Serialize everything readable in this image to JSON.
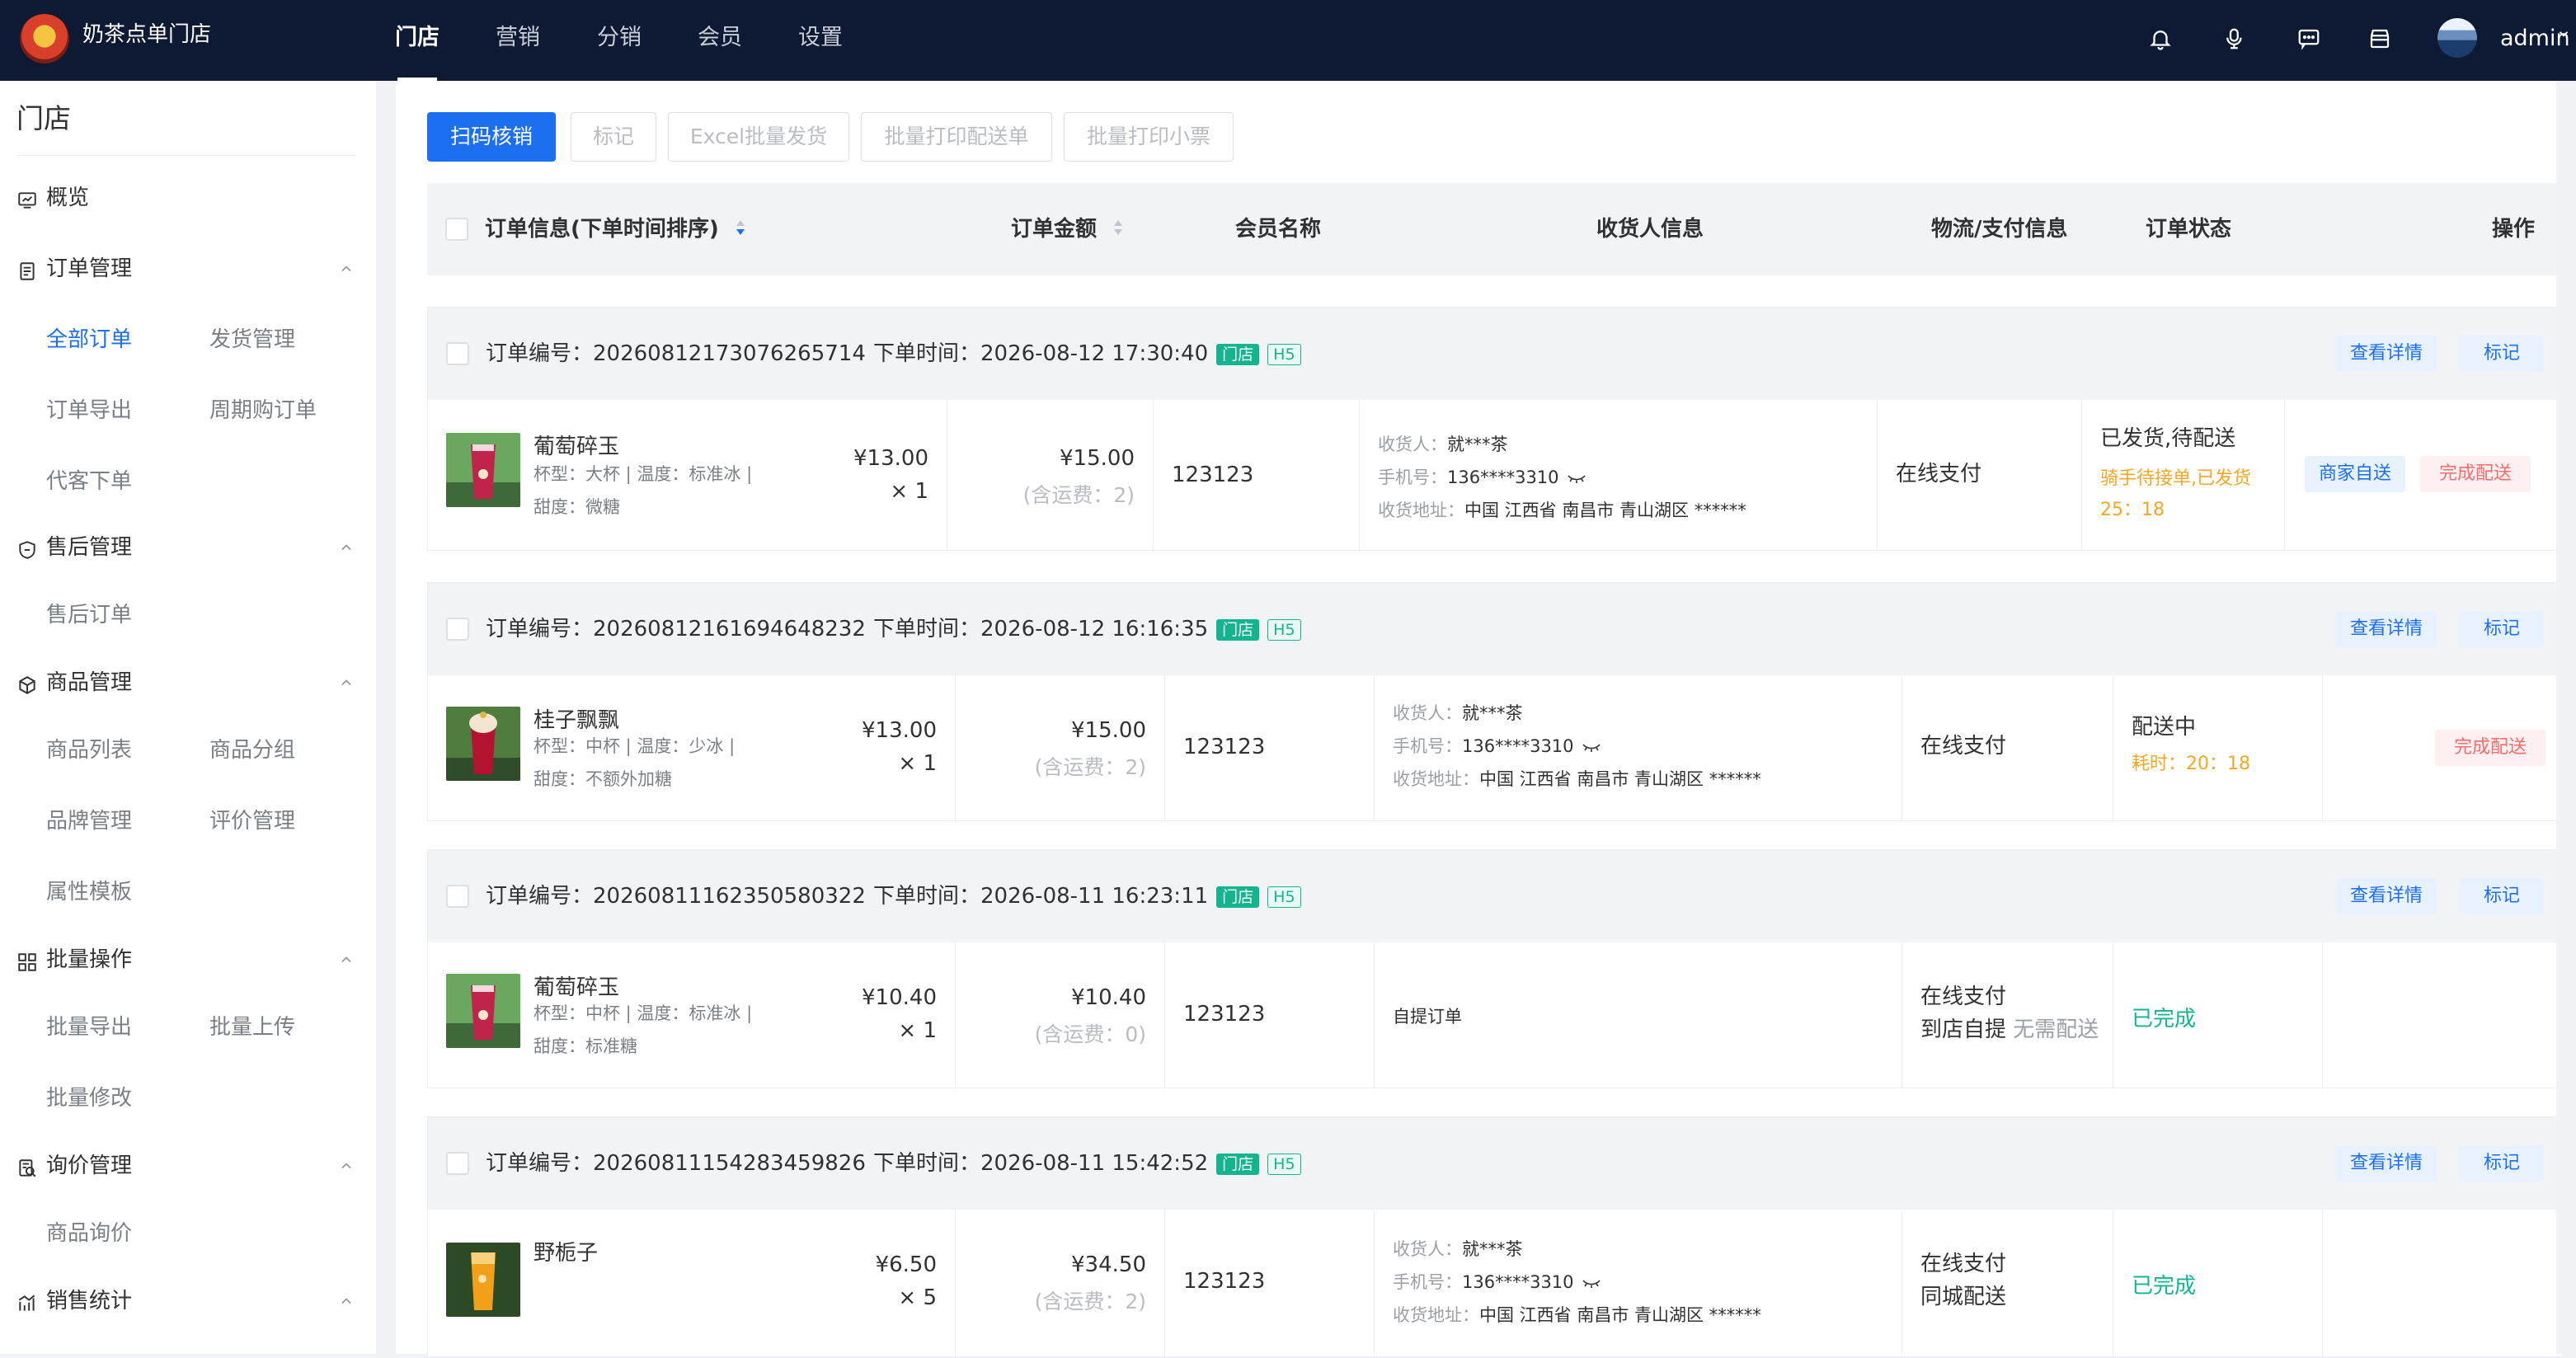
{
  "app": {
    "name": "奶茶点单门店"
  },
  "top_nav": [
    {
      "label": "门店",
      "active": true
    },
    {
      "label": "营销"
    },
    {
      "label": "分销"
    },
    {
      "label": "会员"
    },
    {
      "label": "设置"
    }
  ],
  "user": {
    "name": "admin"
  },
  "sidebar": {
    "title": "门店",
    "overview": "概览",
    "groups": [
      {
        "label": "订单管理",
        "items": [
          "全部订单",
          "发货管理",
          "订单导出",
          "周期购订单",
          "代客下单"
        ]
      },
      {
        "label": "售后管理",
        "items": [
          "售后订单"
        ]
      },
      {
        "label": "商品管理",
        "items": [
          "商品列表",
          "商品分组",
          "品牌管理",
          "评价管理",
          "属性模板"
        ]
      },
      {
        "label": "批量操作",
        "items": [
          "批量导出",
          "批量上传",
          "批量修改"
        ]
      },
      {
        "label": "询价管理",
        "items": [
          "商品询价"
        ]
      },
      {
        "label": "销售统计",
        "items": []
      }
    ],
    "active_item": "全部订单"
  },
  "toolbar": {
    "scan": "扫码核销",
    "mark": "标记",
    "excel": "Excel批量发货",
    "print_delivery": "批量打印配送单",
    "print_receipt": "批量打印小票"
  },
  "table": {
    "headers": [
      "订单信息(下单时间排序)",
      "订单金额",
      "会员名称",
      "收货人信息",
      "物流/支付信息",
      "订单状态",
      "操作"
    ]
  },
  "labels": {
    "order_no": "订单编号：",
    "order_time": "下单时间：",
    "tag_store": "门店",
    "tag_h5": "H5",
    "view_detail": "查看详情",
    "mark": "标记",
    "receiver": "收货人：",
    "phone": "手机号：",
    "address": "收货地址：",
    "merchant_delivery": "商家自送",
    "complete_delivery": "完成配送"
  },
  "orders": [
    {
      "order_no": "20260812173076265714",
      "time": "2026-08-12 17:30:40",
      "product": "葡萄碎玉",
      "spec": "杯型：大杯 | 温度：标准冰 |",
      "sweet": "甜度：微糖",
      "unit_price": "¥13.00",
      "qty": "× 1",
      "total": "¥15.00",
      "fee": "(含运费：2)",
      "member": "123123",
      "receiver": "就***茶",
      "phone": "136****3310",
      "address": "中国 江西省 南昌市 青山湖区 ******",
      "pay": "在线支付",
      "status": "已发货,待配送",
      "note": "骑手待接单,已发货",
      "timer": "25：18"
    },
    {
      "order_no": "20260812161694648232",
      "time": "2026-08-12 16:16:35",
      "product": "桂子飘飘",
      "spec": "杯型：中杯 | 温度：少冰 |",
      "sweet": "甜度：不额外加糖",
      "unit_price": "¥13.00",
      "qty": "× 1",
      "total": "¥15.00",
      "fee": "(含运费：2)",
      "member": "123123",
      "receiver": "就***茶",
      "phone": "136****3310",
      "address": "中国 江西省 南昌市 青山湖区 ******",
      "pay": "在线支付",
      "status": "配送中",
      "note": "耗时：20：18"
    },
    {
      "order_no": "20260811162350580322",
      "time": "2026-08-11 16:23:11",
      "product": "葡萄碎玉",
      "spec": "杯型：中杯 | 温度：标准冰 |",
      "sweet": "甜度：标准糖",
      "unit_price": "¥10.40",
      "qty": "× 1",
      "total": "¥10.40",
      "fee": "(含运费：0)",
      "member": "123123",
      "self_pickup": "自提订单",
      "pay": "在线支付",
      "pay_line2": "到店自提",
      "pay_line2_muted": "无需配送",
      "status": "已完成"
    },
    {
      "order_no": "20260811154283459826",
      "time": "2026-08-11 15:42:52",
      "product": "野栀子",
      "unit_price": "¥6.50",
      "qty": "× 5",
      "total": "¥34.50",
      "fee": "(含运费：2)",
      "member": "123123",
      "receiver": "就***茶",
      "phone": "136****3310",
      "address": "中国 江西省 南昌市 青山湖区 ******",
      "pay": "在线支付",
      "pay_line2": "同城配送",
      "status": "已完成"
    }
  ],
  "colors": {
    "topbar": "#0e1a33",
    "primary": "#1d6ff2",
    "success": "#13b58f",
    "warning": "#f5a623",
    "danger": "#f56c6c"
  },
  "icons": [
    "bell-icon",
    "microphone-icon",
    "chat-icon",
    "store-icon",
    "chevron-down-icon",
    "eye-closed-icon"
  ]
}
